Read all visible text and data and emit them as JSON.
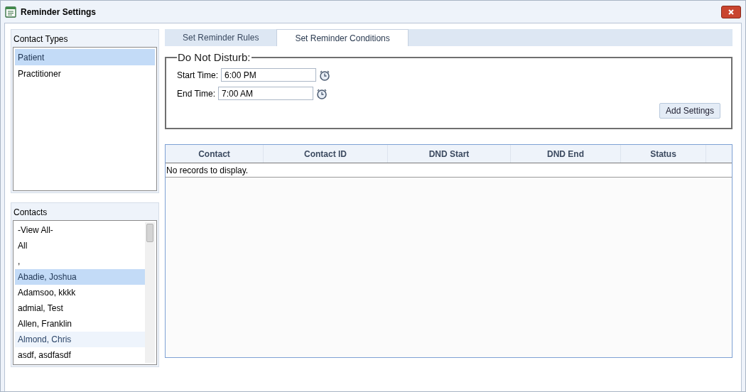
{
  "window": {
    "title": "Reminder Settings"
  },
  "contact_types": {
    "title": "Contact Types",
    "items": [
      {
        "label": "Patient",
        "selected": true
      },
      {
        "label": "Practitioner",
        "selected": false
      }
    ]
  },
  "contacts": {
    "title": "Contacts",
    "items": [
      {
        "label": "-View All-",
        "selected": false,
        "hovered": false
      },
      {
        "label": "All",
        "selected": false,
        "hovered": false
      },
      {
        "label": ",",
        "selected": false,
        "hovered": false
      },
      {
        "label": "Abadie, Joshua",
        "selected": true,
        "hovered": false
      },
      {
        "label": "Adamsoo, kkkk",
        "selected": false,
        "hovered": false
      },
      {
        "label": "admial, Test",
        "selected": false,
        "hovered": false
      },
      {
        "label": "Allen, Franklin",
        "selected": false,
        "hovered": false
      },
      {
        "label": "Almond, Chris",
        "selected": false,
        "hovered": true
      },
      {
        "label": "asdf, asdfasdf",
        "selected": false,
        "hovered": false
      }
    ]
  },
  "tabs": [
    {
      "label": "Set Reminder Rules",
      "selected": false
    },
    {
      "label": "Set Reminder Conditions",
      "selected": true
    }
  ],
  "do_not_disturb": {
    "title": "Do Not Disturb:",
    "fields": [
      {
        "label": "Start Time:",
        "value": "6:00 PM"
      },
      {
        "label": "End Time:",
        "value": "7:00 AM"
      }
    ],
    "button": "Add Settings"
  },
  "table": {
    "columns": [
      "Contact",
      "Contact ID",
      "DND Start",
      "DND End",
      "Status"
    ],
    "empty_message": "No records to display."
  }
}
